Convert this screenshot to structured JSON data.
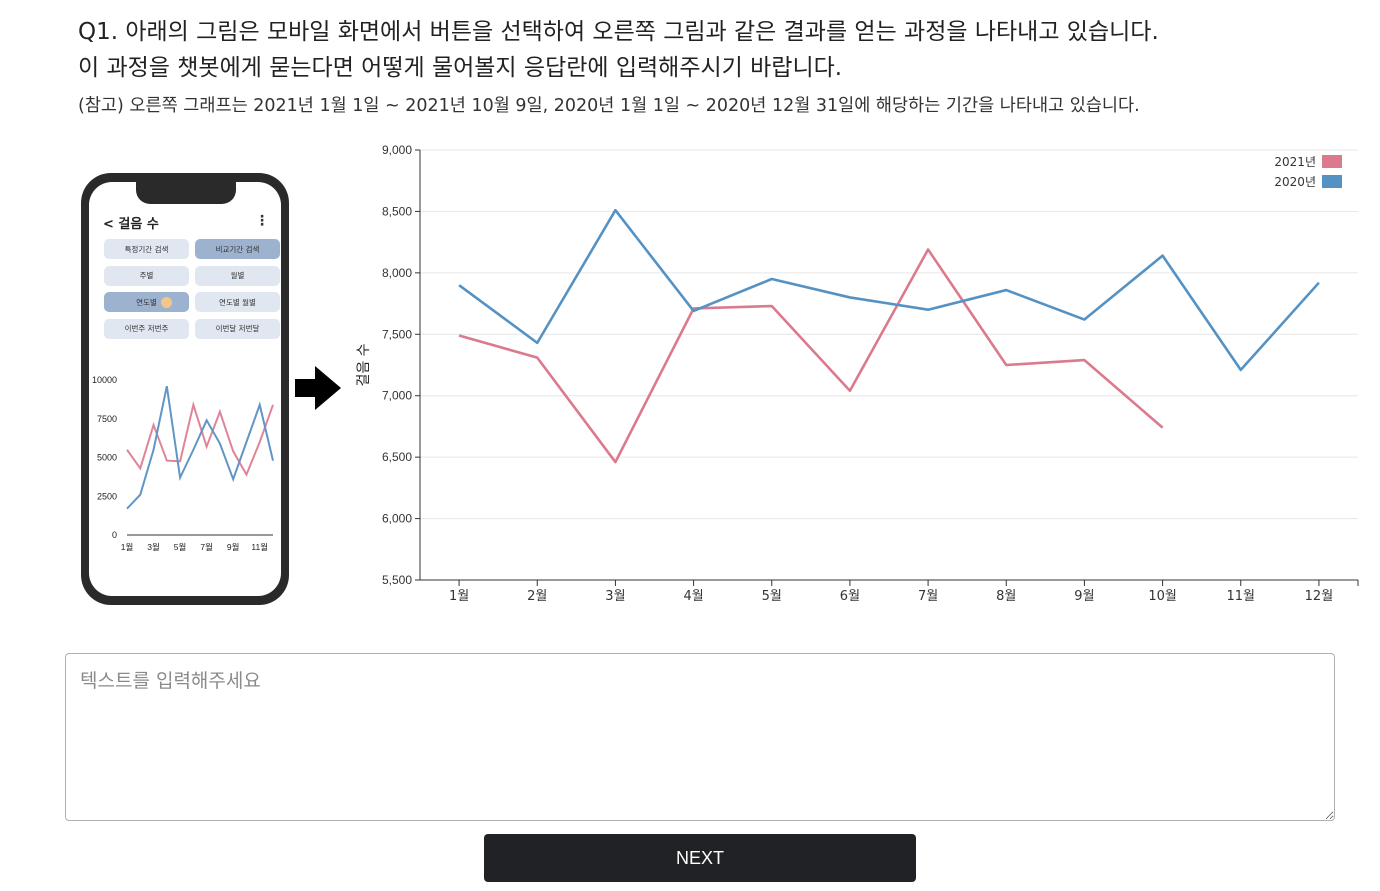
{
  "question": {
    "line1": "Q1. 아래의 그림은 모바일 화면에서 버튼을 선택하여 오른쪽 그림과 같은 결과를 얻는 과정을 나타내고 있습니다.",
    "line2": "이 과정을 챗봇에게 묻는다면 어떻게 물어볼지 응답란에 입력해주시기 바랍니다.",
    "note": "(참고) 오른쪽 그래프는 2021년 1월 1일 ~ 2021년 10월 9일, 2020년 1월 1일 ~ 2020년 12월 31일에 해당하는 기간을 나타내고 있습니다."
  },
  "phone": {
    "title": "< 걸음 수",
    "menu_icon": "vertical-dots-icon",
    "buttons": [
      {
        "label": "특정기간 검색",
        "selected": false
      },
      {
        "label": "비교기간 검색",
        "selected": true
      },
      {
        "label": "주별",
        "selected": false
      },
      {
        "label": "월별",
        "selected": false
      },
      {
        "label": "연도별",
        "selected": true
      },
      {
        "label": "연도별 월별",
        "selected": false
      },
      {
        "label": "이번주 저번주",
        "selected": false
      },
      {
        "label": "이번달 저번달",
        "selected": false
      }
    ]
  },
  "chart_data": [
    {
      "type": "line",
      "categories": [
        "1월",
        "3월",
        "5월",
        "7월",
        "9월",
        "11월"
      ],
      "yticks": [
        "0",
        "2500",
        "5000",
        "7500",
        "10000"
      ],
      "ylim": [
        0,
        10000
      ],
      "x_points": [
        1,
        1.6,
        2.2,
        2.8,
        3.4,
        4.0,
        4.6,
        5.2,
        5.8,
        6.4,
        7.0,
        7.6,
        8.2,
        8.6,
        9.2,
        9.8,
        10.4,
        11.2,
        12
      ],
      "series": [
        {
          "color": "#df8598",
          "values": [
            5500,
            4300,
            7100,
            4800,
            4750,
            8400,
            5700,
            7950,
            5400,
            3900,
            6000,
            8400
          ]
        },
        {
          "color": "#5f96c6",
          "values": [
            1700,
            2600,
            5500,
            9600,
            3700,
            5500,
            7400,
            5900,
            3600,
            6000,
            8400,
            4800
          ]
        }
      ]
    },
    {
      "type": "line",
      "categories": [
        "1월",
        "2월",
        "3월",
        "4월",
        "5월",
        "6월",
        "7월",
        "8월",
        "9월",
        "10월",
        "11월",
        "12월"
      ],
      "ylabel": "걸음 수",
      "ylim": [
        5500,
        9000
      ],
      "yticks": [
        "5,500",
        "6,000",
        "6,500",
        "7,000",
        "7,500",
        "8,000",
        "8,500",
        "9,000"
      ],
      "grid": true,
      "legend": "top-right",
      "series": [
        {
          "name": "2021년",
          "color": "#db7a8d",
          "values": [
            7490,
            7310,
            6460,
            7710,
            7730,
            7040,
            8190,
            7250,
            7290,
            6740
          ]
        },
        {
          "name": "2020년",
          "color": "#5592c4",
          "values": [
            7900,
            7430,
            8510,
            7690,
            7950,
            7800,
            7700,
            7860,
            7620,
            8140,
            7210,
            7920
          ]
        }
      ]
    }
  ],
  "answer": {
    "placeholder": "텍스트를 입력해주세요",
    "value": ""
  },
  "next_label": "NEXT",
  "arrow_icon": "arrow-right-icon"
}
